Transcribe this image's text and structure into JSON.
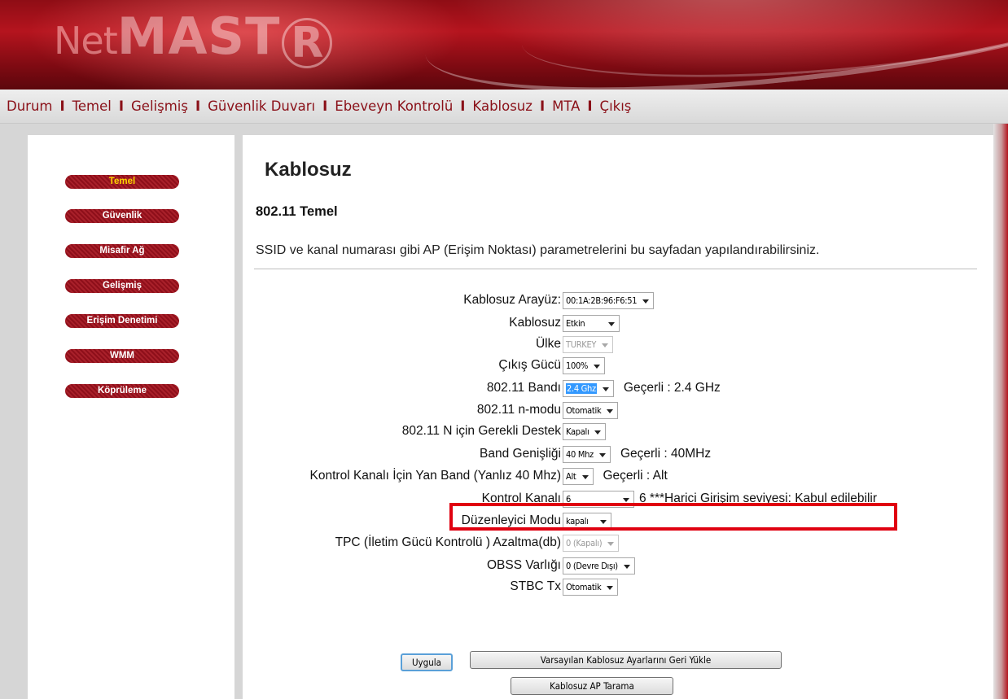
{
  "brand": {
    "net": "Net",
    "master": "MAST",
    "reg_letter": "R",
    "name": "NetMASTER"
  },
  "topnav": {
    "items": [
      "Durum",
      "Temel",
      "Gelişmiş",
      "Güvenlik Duvarı",
      "Ebeveyn Kontrolü",
      "Kablosuz",
      "MTA",
      "Çıkış"
    ],
    "separator": "I"
  },
  "sidebar": {
    "items": [
      {
        "label": "Temel",
        "active": true
      },
      {
        "label": "Güvenlik",
        "active": false
      },
      {
        "label": "Misafir Ağ",
        "active": false
      },
      {
        "label": "Gelişmiş",
        "active": false
      },
      {
        "label": "Erişim Denetimi",
        "active": false
      },
      {
        "label": "WMM",
        "active": false
      },
      {
        "label": "Köprüleme",
        "active": false
      }
    ]
  },
  "main": {
    "title": "Kablosuz",
    "section_title": "802.11 Temel",
    "description": "SSID ve kanal numarası gibi AP (Erişim Noktası) parametrelerini bu sayfadan yapılandırabilirsiniz."
  },
  "form": {
    "rows": [
      {
        "label": "Kablosuz Arayüz:",
        "value": "00:1A:2B:96:F6:51",
        "disabled": false
      },
      {
        "label": "Kablosuz",
        "value": "Etkin",
        "disabled": false
      },
      {
        "label": "Ülke",
        "value": "TURKEY",
        "disabled": true
      },
      {
        "label": "Çıkış Gücü",
        "value": "100%",
        "disabled": false
      },
      {
        "label": "802.11 Bandı",
        "value": "2.4 Ghz",
        "disabled": false,
        "selected_highlight": true,
        "note": "Geçerli :  2.4 GHz"
      },
      {
        "label": "802.11 n-modu",
        "value": "Otomatik",
        "disabled": false
      },
      {
        "label": "802.11 N için Gerekli Destek",
        "value": "Kapalı",
        "disabled": false
      },
      {
        "label": "Band Genişliği",
        "value": "40 Mhz",
        "disabled": false,
        "note": "Geçerli :  40MHz"
      },
      {
        "label": "Kontrol Kanalı İçin Yan Band (Yanlız 40 Mhz)",
        "value": "Alt",
        "disabled": false,
        "note": "Geçerli :  Alt"
      },
      {
        "label": "Kontrol Kanalı",
        "value": "6",
        "disabled": false,
        "note": "6 ***Harici Girişim seviyesi: Kabul edilebilir"
      },
      {
        "label": "Düzenleyici Modu",
        "value": "kapalı",
        "disabled": false
      },
      {
        "label": "TPC (İletim Gücü Kontrolü ) Azaltma(db)",
        "value": "0 (Kapalı)",
        "disabled": true
      },
      {
        "label": "OBSS Varlığı",
        "value": "0 (Devre Dışı)",
        "disabled": false
      },
      {
        "label": "STBC Tx",
        "value": "Otomatik",
        "disabled": false
      }
    ]
  },
  "buttons": {
    "apply": "Uygula",
    "restore_defaults": "Varsayılan Kablosuz Ayarlarını Geri Yükle",
    "scan": "Kablosuz AP Tarama"
  },
  "colors": {
    "brand_red": "#8e0f1a",
    "active_sidebar_text": "#ffd700",
    "highlight_box": "#e00010",
    "select_highlight": "#3399ff"
  }
}
